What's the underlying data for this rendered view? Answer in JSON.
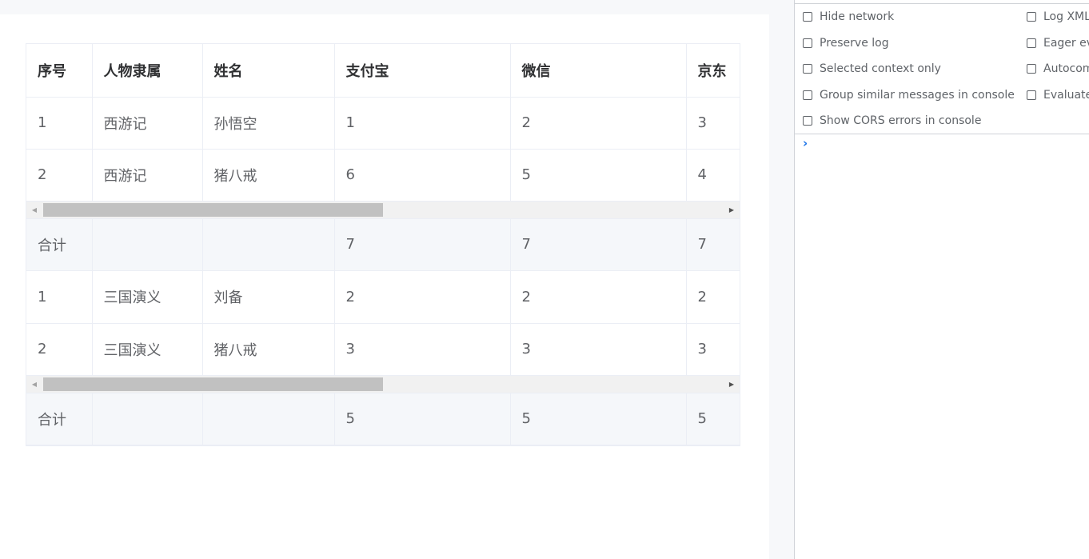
{
  "table": {
    "headers": [
      "序号",
      "人物隶属",
      "姓名",
      "支付宝",
      "微信",
      "京东"
    ],
    "groups": [
      {
        "rows": [
          [
            "1",
            "西游记",
            "孙悟空",
            "1",
            "2",
            "3"
          ],
          [
            "2",
            "西游记",
            "猪八戒",
            "6",
            "5",
            "4"
          ]
        ],
        "summary": [
          "合计",
          "",
          "",
          "7",
          "7",
          "7"
        ],
        "scroll_fraction": 0.5
      },
      {
        "rows": [
          [
            "1",
            "三国演义",
            "刘备",
            "2",
            "2",
            "2"
          ],
          [
            "2",
            "三国演义",
            "猪八戒",
            "3",
            "3",
            "3"
          ]
        ],
        "summary": [
          "合计",
          "",
          "",
          "5",
          "5",
          "5"
        ],
        "scroll_fraction": 0.5
      }
    ]
  },
  "devtools": {
    "options_left": [
      {
        "label": "Hide network",
        "checked": false
      },
      {
        "label": "Preserve log",
        "checked": false
      },
      {
        "label": "Selected context only",
        "checked": false
      },
      {
        "label": "Group similar messages in console",
        "checked": false
      },
      {
        "label": "Show CORS errors in console",
        "checked": false
      }
    ],
    "options_right": [
      {
        "label": "Log XMLHttpRequests",
        "checked": false
      },
      {
        "label": "Eager evaluation",
        "checked": false
      },
      {
        "label": "Autocomplete from history",
        "checked": false
      },
      {
        "label": "Evaluate triggers user activation",
        "checked": false
      }
    ],
    "prompt_symbol": "›"
  }
}
